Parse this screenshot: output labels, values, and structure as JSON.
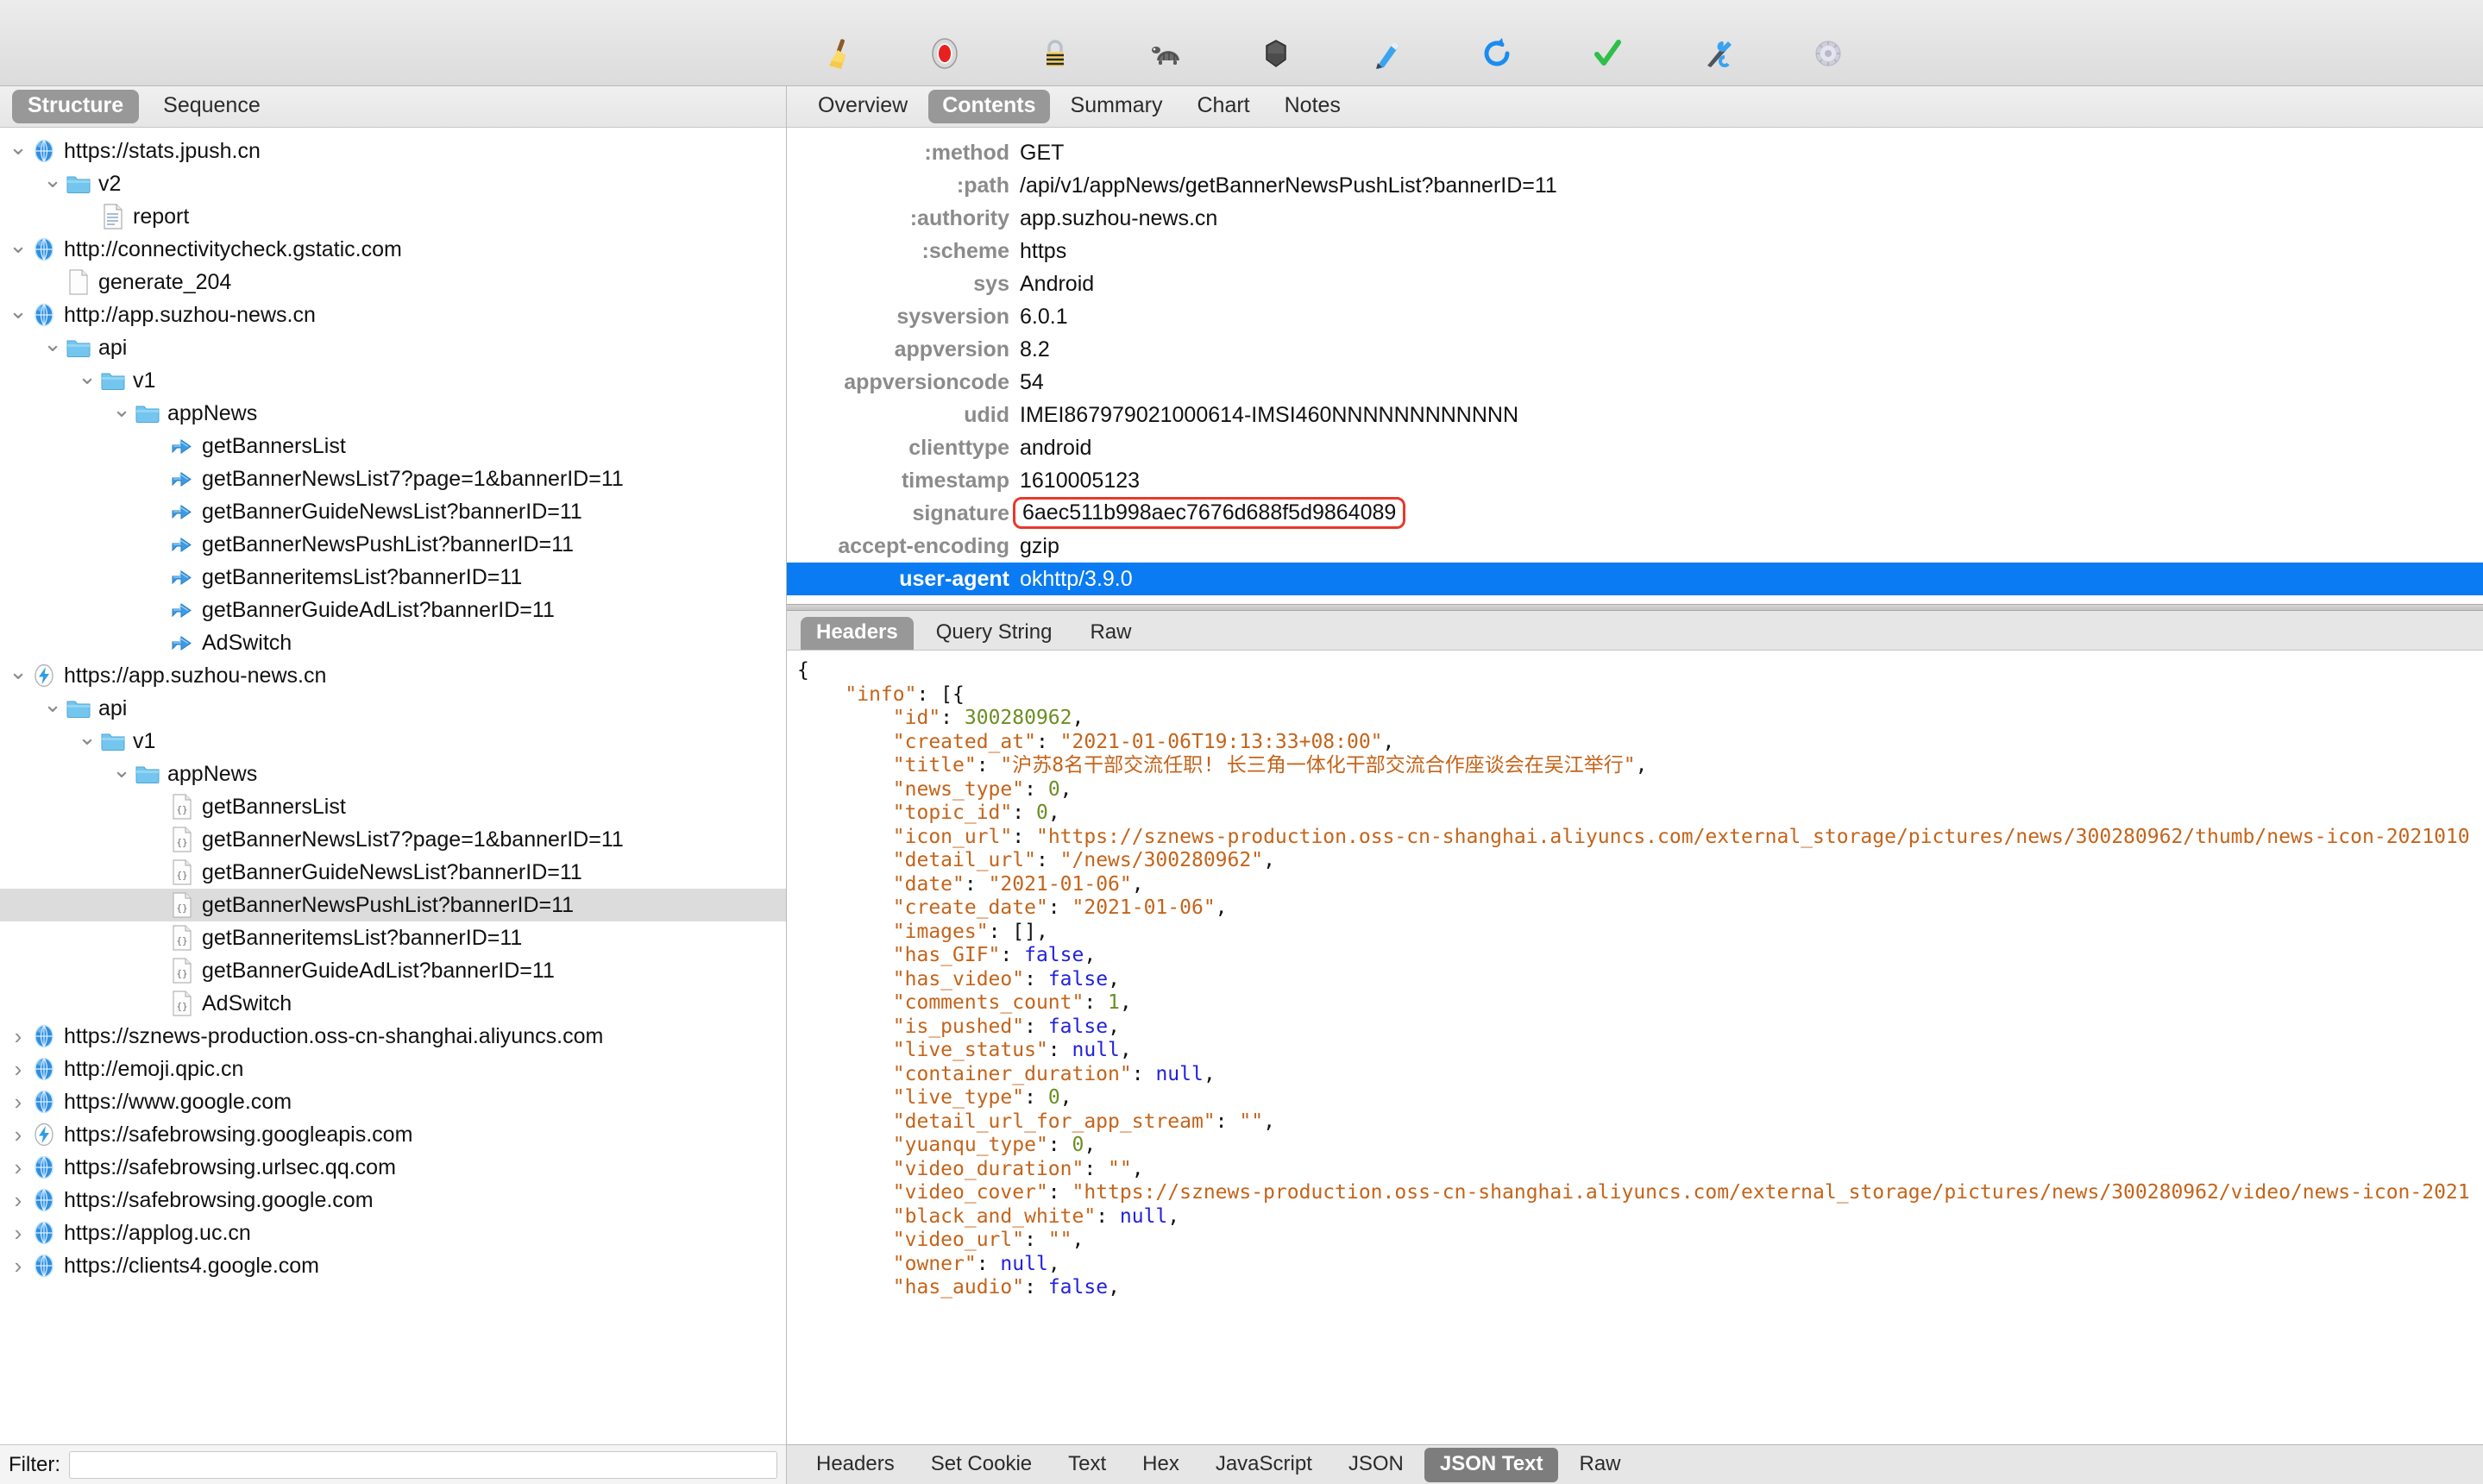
{
  "toolbar": {
    "buttons": [
      {
        "name": "clear-icon",
        "tooltip": "Clear"
      },
      {
        "name": "record-icon",
        "tooltip": "Start/Stop Recording"
      },
      {
        "name": "ssl-lock-icon",
        "tooltip": "SSL Proxying"
      },
      {
        "name": "throttle-turtle-icon",
        "tooltip": "Throttling"
      },
      {
        "name": "breakpoints-icon",
        "tooltip": "Breakpoints"
      },
      {
        "name": "compose-pen-icon",
        "tooltip": "Compose"
      },
      {
        "name": "repeat-icon",
        "tooltip": "Repeat"
      },
      {
        "name": "validate-check-icon",
        "tooltip": "Validate"
      },
      {
        "name": "tools-icon",
        "tooltip": "Tools"
      },
      {
        "name": "settings-gear-icon",
        "tooltip": "Settings"
      }
    ]
  },
  "left_panel": {
    "segments": [
      {
        "label": "Structure",
        "selected": true
      },
      {
        "label": "Sequence",
        "selected": false
      }
    ],
    "filter": {
      "label": "Filter:",
      "value": "",
      "placeholder": ""
    },
    "tree": [
      {
        "depth": 0,
        "twisty": "down",
        "icon": "globe-icon",
        "label": "https://stats.jpush.cn",
        "selected": false
      },
      {
        "depth": 1,
        "twisty": "down",
        "icon": "folder-icon",
        "label": "v2",
        "selected": false
      },
      {
        "depth": 2,
        "twisty": "none",
        "icon": "doc-lines-icon",
        "label": "report",
        "selected": false
      },
      {
        "depth": 0,
        "twisty": "down",
        "icon": "globe-icon",
        "label": "http://connectivitycheck.gstatic.com",
        "selected": false
      },
      {
        "depth": 1,
        "twisty": "none",
        "icon": "doc-blank-icon",
        "label": "generate_204",
        "selected": false
      },
      {
        "depth": 0,
        "twisty": "down",
        "icon": "globe-icon",
        "label": "http://app.suzhou-news.cn",
        "selected": false
      },
      {
        "depth": 1,
        "twisty": "down",
        "icon": "folder-icon",
        "label": "api",
        "selected": false
      },
      {
        "depth": 2,
        "twisty": "down",
        "icon": "folder-icon",
        "label": "v1",
        "selected": false
      },
      {
        "depth": 3,
        "twisty": "down",
        "icon": "folder-icon",
        "label": "appNews",
        "selected": false
      },
      {
        "depth": 4,
        "twisty": "none",
        "icon": "redirect-icon",
        "label": "getBannersList",
        "selected": false
      },
      {
        "depth": 4,
        "twisty": "none",
        "icon": "redirect-icon",
        "label": "getBannerNewsList7?page=1&bannerID=11",
        "selected": false
      },
      {
        "depth": 4,
        "twisty": "none",
        "icon": "redirect-icon",
        "label": "getBannerGuideNewsList?bannerID=11",
        "selected": false
      },
      {
        "depth": 4,
        "twisty": "none",
        "icon": "redirect-icon",
        "label": "getBannerNewsPushList?bannerID=11",
        "selected": false
      },
      {
        "depth": 4,
        "twisty": "none",
        "icon": "redirect-icon",
        "label": "getBanneritemsList?bannerID=11",
        "selected": false
      },
      {
        "depth": 4,
        "twisty": "none",
        "icon": "redirect-icon",
        "label": "getBannerGuideAdList?bannerID=11",
        "selected": false
      },
      {
        "depth": 4,
        "twisty": "none",
        "icon": "redirect-icon",
        "label": "AdSwitch",
        "selected": false
      },
      {
        "depth": 0,
        "twisty": "down",
        "icon": "bolt-icon",
        "label": "https://app.suzhou-news.cn",
        "selected": false
      },
      {
        "depth": 1,
        "twisty": "down",
        "icon": "folder-icon",
        "label": "api",
        "selected": false
      },
      {
        "depth": 2,
        "twisty": "down",
        "icon": "folder-icon",
        "label": "v1",
        "selected": false
      },
      {
        "depth": 3,
        "twisty": "down",
        "icon": "folder-icon",
        "label": "appNews",
        "selected": false
      },
      {
        "depth": 4,
        "twisty": "none",
        "icon": "json-doc-icon",
        "label": "getBannersList",
        "selected": false
      },
      {
        "depth": 4,
        "twisty": "none",
        "icon": "json-doc-icon",
        "label": "getBannerNewsList7?page=1&bannerID=11",
        "selected": false
      },
      {
        "depth": 4,
        "twisty": "none",
        "icon": "json-doc-icon",
        "label": "getBannerGuideNewsList?bannerID=11",
        "selected": false
      },
      {
        "depth": 4,
        "twisty": "none",
        "icon": "json-doc-icon",
        "label": "getBannerNewsPushList?bannerID=11",
        "selected": true
      },
      {
        "depth": 4,
        "twisty": "none",
        "icon": "json-doc-icon",
        "label": "getBanneritemsList?bannerID=11",
        "selected": false
      },
      {
        "depth": 4,
        "twisty": "none",
        "icon": "json-doc-icon",
        "label": "getBannerGuideAdList?bannerID=11",
        "selected": false
      },
      {
        "depth": 4,
        "twisty": "none",
        "icon": "json-doc-icon",
        "label": "AdSwitch",
        "selected": false
      },
      {
        "depth": 0,
        "twisty": "right",
        "icon": "globe-icon",
        "label": "https://sznews-production.oss-cn-shanghai.aliyuncs.com",
        "selected": false
      },
      {
        "depth": 0,
        "twisty": "right",
        "icon": "globe-icon",
        "label": "http://emoji.qpic.cn",
        "selected": false
      },
      {
        "depth": 0,
        "twisty": "right",
        "icon": "globe-icon",
        "label": "https://www.google.com",
        "selected": false
      },
      {
        "depth": 0,
        "twisty": "right",
        "icon": "bolt-icon",
        "label": "https://safebrowsing.googleapis.com",
        "selected": false
      },
      {
        "depth": 0,
        "twisty": "right",
        "icon": "globe-icon",
        "label": "https://safebrowsing.urlsec.qq.com",
        "selected": false
      },
      {
        "depth": 0,
        "twisty": "right",
        "icon": "globe-icon",
        "label": "https://safebrowsing.google.com",
        "selected": false
      },
      {
        "depth": 0,
        "twisty": "right",
        "icon": "globe-icon",
        "label": "https://applog.uc.cn",
        "selected": false
      },
      {
        "depth": 0,
        "twisty": "right",
        "icon": "globe-icon",
        "label": "https://clients4.google.com",
        "selected": false
      }
    ]
  },
  "right_panel": {
    "tabs": [
      {
        "label": "Overview",
        "selected": false
      },
      {
        "label": "Contents",
        "selected": true
      },
      {
        "label": "Summary",
        "selected": false
      },
      {
        "label": "Chart",
        "selected": false
      },
      {
        "label": "Notes",
        "selected": false
      }
    ],
    "request_subtabs": [
      {
        "label": "Headers",
        "selected": true
      },
      {
        "label": "Query String",
        "selected": false
      },
      {
        "label": "Raw",
        "selected": false
      }
    ],
    "response_subtabs": [
      {
        "label": "Headers",
        "selected": false
      },
      {
        "label": "Set Cookie",
        "selected": false
      },
      {
        "label": "Text",
        "selected": false
      },
      {
        "label": "Hex",
        "selected": false
      },
      {
        "label": "JavaScript",
        "selected": false
      },
      {
        "label": "JSON",
        "selected": false
      },
      {
        "label": "JSON Text",
        "selected": true
      },
      {
        "label": "Raw",
        "selected": false
      }
    ],
    "headers": [
      {
        "key": ":method",
        "value": "GET",
        "selected": false,
        "boxed": false
      },
      {
        "key": ":path",
        "value": "/api/v1/appNews/getBannerNewsPushList?bannerID=11",
        "selected": false,
        "boxed": false
      },
      {
        "key": ":authority",
        "value": "app.suzhou-news.cn",
        "selected": false,
        "boxed": false
      },
      {
        "key": ":scheme",
        "value": "https",
        "selected": false,
        "boxed": false
      },
      {
        "key": "sys",
        "value": "Android",
        "selected": false,
        "boxed": false
      },
      {
        "key": "sysversion",
        "value": "6.0.1",
        "selected": false,
        "boxed": false
      },
      {
        "key": "appversion",
        "value": "8.2",
        "selected": false,
        "boxed": false
      },
      {
        "key": "appversioncode",
        "value": "54",
        "selected": false,
        "boxed": false
      },
      {
        "key": "udid",
        "value": "IMEI867979021000614-IMSI460NNNNNNNNNNNN",
        "selected": false,
        "boxed": false
      },
      {
        "key": "clienttype",
        "value": "android",
        "selected": false,
        "boxed": false
      },
      {
        "key": "timestamp",
        "value": "1610005123",
        "selected": false,
        "boxed": false
      },
      {
        "key": "signature",
        "value": "6aec511b998aec7676d688f5d9864089",
        "selected": false,
        "boxed": true
      },
      {
        "key": "accept-encoding",
        "value": "gzip",
        "selected": false,
        "boxed": false
      },
      {
        "key": "user-agent",
        "value": "okhttp/3.9.0",
        "selected": true,
        "boxed": false
      }
    ],
    "response_body_lines": [
      [
        {
          "t": "p",
          "v": "{"
        }
      ],
      [
        {
          "t": "p",
          "v": "    "
        },
        {
          "t": "k",
          "v": "\"info\""
        },
        {
          "t": "p",
          "v": ": [{"
        }
      ],
      [
        {
          "t": "p",
          "v": "        "
        },
        {
          "t": "k",
          "v": "\"id\""
        },
        {
          "t": "p",
          "v": ": "
        },
        {
          "t": "n",
          "v": "300280962"
        },
        {
          "t": "p",
          "v": ","
        }
      ],
      [
        {
          "t": "p",
          "v": "        "
        },
        {
          "t": "k",
          "v": "\"created_at\""
        },
        {
          "t": "p",
          "v": ": "
        },
        {
          "t": "s",
          "v": "\"2021-01-06T19:13:33+08:00\""
        },
        {
          "t": "p",
          "v": ","
        }
      ],
      [
        {
          "t": "p",
          "v": "        "
        },
        {
          "t": "k",
          "v": "\"title\""
        },
        {
          "t": "p",
          "v": ": "
        },
        {
          "t": "s",
          "v": "\"沪苏8名干部交流任职! 长三角一体化干部交流合作座谈会在吴江举行\""
        },
        {
          "t": "p",
          "v": ","
        }
      ],
      [
        {
          "t": "p",
          "v": "        "
        },
        {
          "t": "k",
          "v": "\"news_type\""
        },
        {
          "t": "p",
          "v": ": "
        },
        {
          "t": "n",
          "v": "0"
        },
        {
          "t": "p",
          "v": ","
        }
      ],
      [
        {
          "t": "p",
          "v": "        "
        },
        {
          "t": "k",
          "v": "\"topic_id\""
        },
        {
          "t": "p",
          "v": ": "
        },
        {
          "t": "n",
          "v": "0"
        },
        {
          "t": "p",
          "v": ","
        }
      ],
      [
        {
          "t": "p",
          "v": "        "
        },
        {
          "t": "k",
          "v": "\"icon_url\""
        },
        {
          "t": "p",
          "v": ": "
        },
        {
          "t": "s",
          "v": "\"https://sznews-production.oss-cn-shanghai.aliyuncs.com/external_storage/pictures/news/300280962/thumb/news-icon-2021010"
        }
      ],
      [
        {
          "t": "p",
          "v": "        "
        },
        {
          "t": "k",
          "v": "\"detail_url\""
        },
        {
          "t": "p",
          "v": ": "
        },
        {
          "t": "s",
          "v": "\"/news/300280962\""
        },
        {
          "t": "p",
          "v": ","
        }
      ],
      [
        {
          "t": "p",
          "v": "        "
        },
        {
          "t": "k",
          "v": "\"date\""
        },
        {
          "t": "p",
          "v": ": "
        },
        {
          "t": "s",
          "v": "\"2021-01-06\""
        },
        {
          "t": "p",
          "v": ","
        }
      ],
      [
        {
          "t": "p",
          "v": "        "
        },
        {
          "t": "k",
          "v": "\"create_date\""
        },
        {
          "t": "p",
          "v": ": "
        },
        {
          "t": "s",
          "v": "\"2021-01-06\""
        },
        {
          "t": "p",
          "v": ","
        }
      ],
      [
        {
          "t": "p",
          "v": "        "
        },
        {
          "t": "k",
          "v": "\"images\""
        },
        {
          "t": "p",
          "v": ": [],"
        }
      ],
      [
        {
          "t": "p",
          "v": "        "
        },
        {
          "t": "k",
          "v": "\"has_GIF\""
        },
        {
          "t": "p",
          "v": ": "
        },
        {
          "t": "b",
          "v": "false"
        },
        {
          "t": "p",
          "v": ","
        }
      ],
      [
        {
          "t": "p",
          "v": "        "
        },
        {
          "t": "k",
          "v": "\"has_video\""
        },
        {
          "t": "p",
          "v": ": "
        },
        {
          "t": "b",
          "v": "false"
        },
        {
          "t": "p",
          "v": ","
        }
      ],
      [
        {
          "t": "p",
          "v": "        "
        },
        {
          "t": "k",
          "v": "\"comments_count\""
        },
        {
          "t": "p",
          "v": ": "
        },
        {
          "t": "n",
          "v": "1"
        },
        {
          "t": "p",
          "v": ","
        }
      ],
      [
        {
          "t": "p",
          "v": "        "
        },
        {
          "t": "k",
          "v": "\"is_pushed\""
        },
        {
          "t": "p",
          "v": ": "
        },
        {
          "t": "b",
          "v": "false"
        },
        {
          "t": "p",
          "v": ","
        }
      ],
      [
        {
          "t": "p",
          "v": "        "
        },
        {
          "t": "k",
          "v": "\"live_status\""
        },
        {
          "t": "p",
          "v": ": "
        },
        {
          "t": "b",
          "v": "null"
        },
        {
          "t": "p",
          "v": ","
        }
      ],
      [
        {
          "t": "p",
          "v": "        "
        },
        {
          "t": "k",
          "v": "\"container_duration\""
        },
        {
          "t": "p",
          "v": ": "
        },
        {
          "t": "b",
          "v": "null"
        },
        {
          "t": "p",
          "v": ","
        }
      ],
      [
        {
          "t": "p",
          "v": "        "
        },
        {
          "t": "k",
          "v": "\"live_type\""
        },
        {
          "t": "p",
          "v": ": "
        },
        {
          "t": "n",
          "v": "0"
        },
        {
          "t": "p",
          "v": ","
        }
      ],
      [
        {
          "t": "p",
          "v": "        "
        },
        {
          "t": "k",
          "v": "\"detail_url_for_app_stream\""
        },
        {
          "t": "p",
          "v": ": "
        },
        {
          "t": "s",
          "v": "\"\""
        },
        {
          "t": "p",
          "v": ","
        }
      ],
      [
        {
          "t": "p",
          "v": "        "
        },
        {
          "t": "k",
          "v": "\"yuanqu_type\""
        },
        {
          "t": "p",
          "v": ": "
        },
        {
          "t": "n",
          "v": "0"
        },
        {
          "t": "p",
          "v": ","
        }
      ],
      [
        {
          "t": "p",
          "v": "        "
        },
        {
          "t": "k",
          "v": "\"video_duration\""
        },
        {
          "t": "p",
          "v": ": "
        },
        {
          "t": "s",
          "v": "\"\""
        },
        {
          "t": "p",
          "v": ","
        }
      ],
      [
        {
          "t": "p",
          "v": "        "
        },
        {
          "t": "k",
          "v": "\"video_cover\""
        },
        {
          "t": "p",
          "v": ": "
        },
        {
          "t": "s",
          "v": "\"https://sznews-production.oss-cn-shanghai.aliyuncs.com/external_storage/pictures/news/300280962/video/news-icon-2021"
        }
      ],
      [
        {
          "t": "p",
          "v": "        "
        },
        {
          "t": "k",
          "v": "\"black_and_white\""
        },
        {
          "t": "p",
          "v": ": "
        },
        {
          "t": "b",
          "v": "null"
        },
        {
          "t": "p",
          "v": ","
        }
      ],
      [
        {
          "t": "p",
          "v": "        "
        },
        {
          "t": "k",
          "v": "\"video_url\""
        },
        {
          "t": "p",
          "v": ": "
        },
        {
          "t": "s",
          "v": "\"\""
        },
        {
          "t": "p",
          "v": ","
        }
      ],
      [
        {
          "t": "p",
          "v": "        "
        },
        {
          "t": "k",
          "v": "\"owner\""
        },
        {
          "t": "p",
          "v": ": "
        },
        {
          "t": "b",
          "v": "null"
        },
        {
          "t": "p",
          "v": ","
        }
      ],
      [
        {
          "t": "p",
          "v": "        "
        },
        {
          "t": "k",
          "v": "\"has_audio\""
        },
        {
          "t": "p",
          "v": ": "
        },
        {
          "t": "b",
          "v": "false"
        },
        {
          "t": "p",
          "v": ","
        }
      ]
    ]
  },
  "colors": {
    "selection_blue": "#0a7bf2",
    "row_selected_gray": "#dcdcdc",
    "tab_active_gray": "#989898",
    "highlight_box_red": "#e8382a",
    "json_string": "#c4641a",
    "json_number": "#6b8e23",
    "json_literal": "#2222dd"
  }
}
